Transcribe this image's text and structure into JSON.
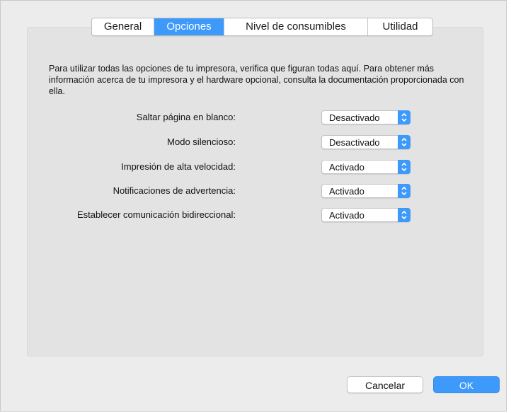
{
  "tabs": [
    {
      "label": "General",
      "active": false
    },
    {
      "label": "Opciones",
      "active": true
    },
    {
      "label": "Nivel de consumibles",
      "active": false
    },
    {
      "label": "Utilidad",
      "active": false
    }
  ],
  "description": "Para utilizar todas las opciones de tu impresora, verifica que figuran todas aquí. Para obtener más información acerca de tu impresora y el hardware opcional, consulta la documentación proporcionada con ella.",
  "options": [
    {
      "label": "Saltar página en blanco:",
      "value": "Desactivado"
    },
    {
      "label": "Modo silencioso:",
      "value": "Desactivado"
    },
    {
      "label": "Impresión de alta velocidad:",
      "value": "Activado"
    },
    {
      "label": "Notificaciones de advertencia:",
      "value": "Activado"
    },
    {
      "label": "Establecer comunicación bidireccional:",
      "value": "Activado"
    }
  ],
  "buttons": {
    "cancel_label": "Cancelar",
    "ok_label": "OK"
  },
  "colors": {
    "accent": "#3d9afa",
    "window_bg": "#ececec",
    "panel_bg": "#e3e3e3"
  },
  "icons": {
    "popup_arrows": "updown-chevron-icon"
  }
}
